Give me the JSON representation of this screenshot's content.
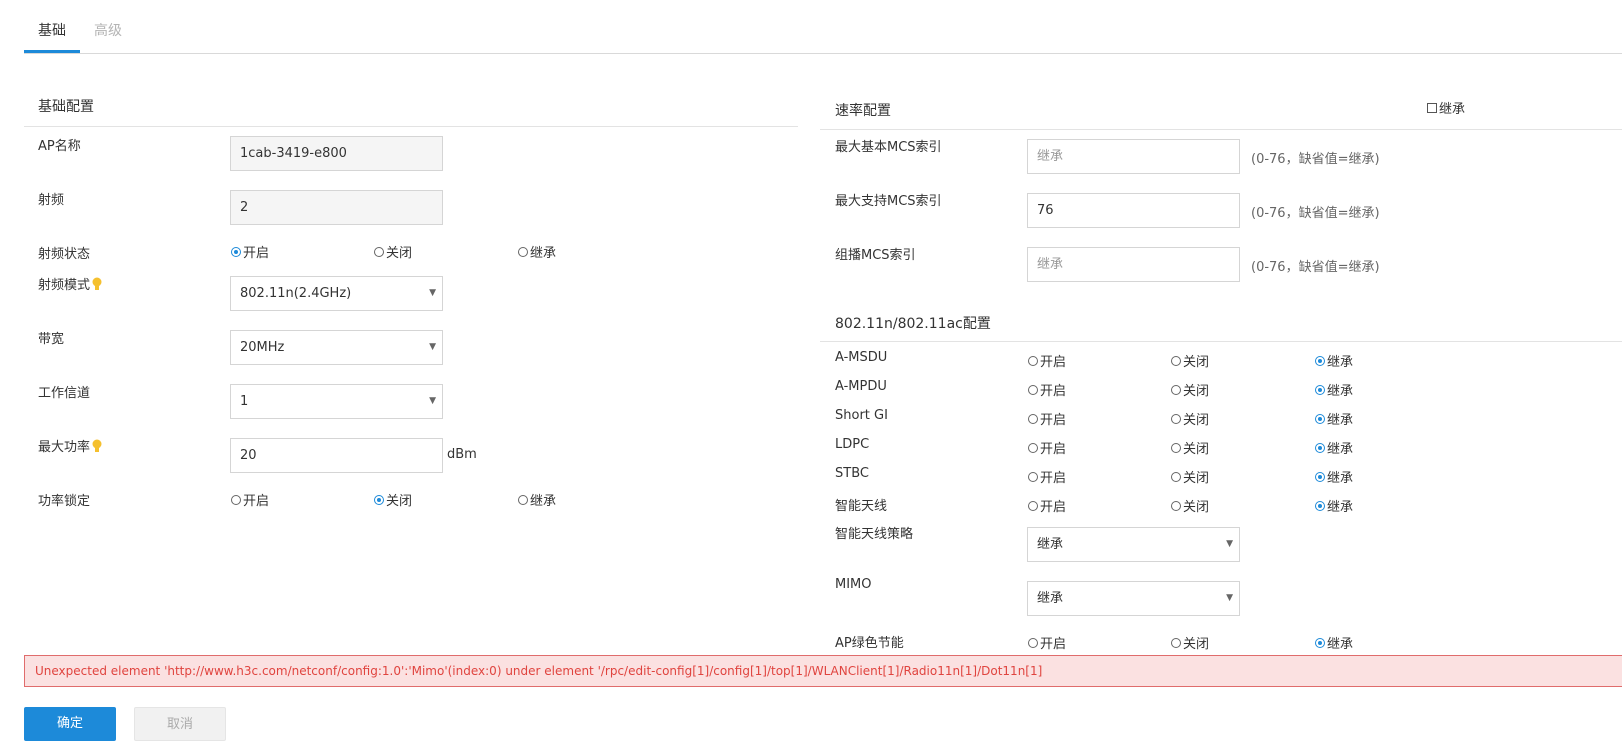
{
  "tabs": [
    {
      "label": "基础"
    },
    {
      "label": "高级"
    }
  ],
  "basic": {
    "title": "基础配置",
    "ap_name": {
      "label": "AP名称",
      "value": "1cab-3419-e800"
    },
    "radio": {
      "label": "射频",
      "value": "2"
    },
    "radio_status": {
      "label": "射频状态",
      "options": [
        "开启",
        "关闭",
        "继承"
      ],
      "selected": "开启"
    },
    "radio_mode": {
      "label": "射频模式",
      "value": "802.11n(2.4GHz)"
    },
    "bandwidth": {
      "label": "带宽",
      "value": "20MHz"
    },
    "channel": {
      "label": "工作信道",
      "value": "1"
    },
    "max_power": {
      "label": "最大功率",
      "value": "20",
      "unit": "dBm"
    },
    "power_lock": {
      "label": "功率锁定",
      "options": [
        "开启",
        "关闭",
        "继承"
      ],
      "selected": "关闭"
    }
  },
  "rate": {
    "title": "速率配置",
    "inherit_label": "继承",
    "inherit_checked": false,
    "max_basic_mcs": {
      "label": "最大基本MCS索引",
      "placeholder": "继承",
      "value": "",
      "hint": "(0-76，缺省值=继承)"
    },
    "max_support_mcs": {
      "label": "最大支持MCS索引",
      "placeholder": "",
      "value": "76",
      "hint": "(0-76，缺省值=继承)"
    },
    "multicast_mcs": {
      "label": "组播MCS索引",
      "placeholder": "继承",
      "value": "",
      "hint": "(0-76，缺省值=继承)"
    }
  },
  "dot11n": {
    "title": "802.11n/802.11ac配置",
    "options": [
      "开启",
      "关闭",
      "继承"
    ],
    "rows": [
      {
        "label": "A-MSDU",
        "selected": "继承"
      },
      {
        "label": "A-MPDU",
        "selected": "继承"
      },
      {
        "label": "Short GI",
        "selected": "继承"
      },
      {
        "label": "LDPC",
        "selected": "继承"
      },
      {
        "label": "STBC",
        "selected": "继承"
      },
      {
        "label": "智能天线",
        "selected": "继承"
      }
    ],
    "smart_antenna_policy": {
      "label": "智能天线策略",
      "value": "继承"
    },
    "mimo": {
      "label": "MIMO",
      "value": "继承"
    },
    "ap_green": {
      "label": "AP绿色节能",
      "selected": "继承"
    }
  },
  "error": {
    "message": "Unexpected element 'http://www.h3c.com/netconf/config:1.0':'Mimo'(index:0) under element '/rpc/edit-config[1]/config[1]/top[1]/WLANClient[1]/Radio11n[1]/Dot11n[1]"
  },
  "buttons": {
    "ok": "确定",
    "cancel": "取消"
  },
  "colors": {
    "accent": "#1d8ad9",
    "error_text": "#e0443f",
    "error_bg": "#fbe1e1",
    "tip_icon": "#f5c02e"
  }
}
